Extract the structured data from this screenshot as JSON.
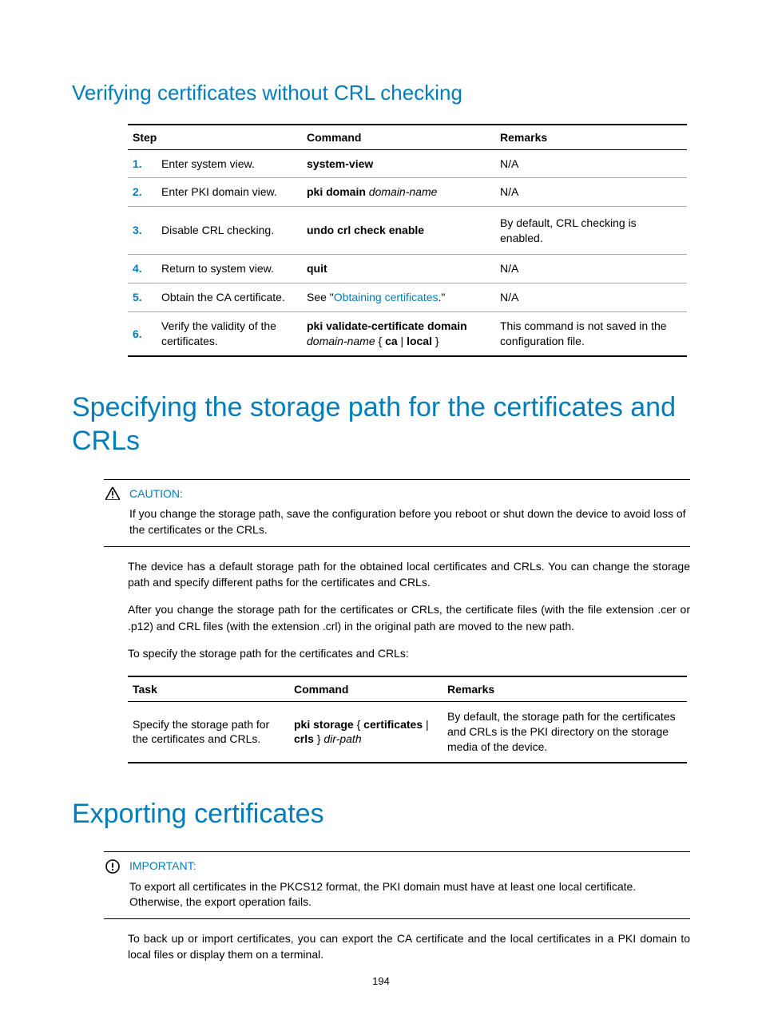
{
  "headings": {
    "verify": "Verifying certificates without CRL checking",
    "storage": "Specifying the storage path for the certificates and CRLs",
    "export": "Exporting certificates"
  },
  "table1": {
    "headers": {
      "step": "Step",
      "command": "Command",
      "remarks": "Remarks"
    },
    "rows": [
      {
        "num": "1.",
        "step": "Enter system view.",
        "cmd_b1": "system-view",
        "remarks": "N/A"
      },
      {
        "num": "2.",
        "step": "Enter PKI domain view.",
        "cmd_b1": "pki domain",
        "cmd_i1": " domain-name",
        "remarks": "N/A"
      },
      {
        "num": "3.",
        "step": "Disable CRL checking.",
        "cmd_b1": "undo crl check enable",
        "remarks": "By default, CRL checking is enabled."
      },
      {
        "num": "4.",
        "step": "Return to system view.",
        "cmd_b1": "quit",
        "remarks": "N/A"
      },
      {
        "num": "5.",
        "step": "Obtain the CA certificate.",
        "cmd_pre": "See \"",
        "cmd_link": "Obtaining certificates",
        "cmd_post": ".\"",
        "remarks": "N/A"
      },
      {
        "num": "6.",
        "step": "Verify the validity of the certificates.",
        "cmd_b1": "pki validate-certificate domain",
        "cmd_nl": true,
        "cmd_i1": "domain-name",
        "cmd_plain": " { ",
        "cmd_b2": "ca",
        "cmd_plain2": " | ",
        "cmd_b3": "local",
        "cmd_plain3": " }",
        "remarks": "This command is not saved in the configuration file."
      }
    ]
  },
  "caution": {
    "label": "CAUTION:",
    "text": "If you change the storage path, save the configuration before you reboot or shut down the device to avoid loss of the certificates or the CRLs."
  },
  "storage_paras": {
    "p1": "The device has a default storage path for the obtained local certificates and CRLs. You can change the storage path and specify different paths for the certificates and CRLs.",
    "p2": "After you change the storage path for the certificates or CRLs, the certificate files (with the file extension .cer or .p12) and CRL files (with the extension .crl) in the original path are moved to the new path.",
    "p3": "To specify the storage path for the certificates and CRLs:"
  },
  "table2": {
    "headers": {
      "task": "Task",
      "command": "Command",
      "remarks": "Remarks"
    },
    "row": {
      "task": "Specify the storage path for the certificates and CRLs.",
      "cmd_b1": "pki storage",
      "cmd_plain1": " { ",
      "cmd_b2": "certificates",
      "cmd_plain2": " | ",
      "cmd_b3": "crls",
      "cmd_plain3": " } ",
      "cmd_i1": "dir-path",
      "remarks": "By default, the storage path for the certificates and CRLs is the PKI directory on the storage media of the device."
    }
  },
  "important": {
    "label": "IMPORTANT:",
    "text": "To export all certificates in the PKCS12 format, the PKI domain must have at least one local certificate. Otherwise, the export operation fails."
  },
  "export_para": "To back up or import certificates, you can export the CA certificate and the local certificates in a PKI domain to local files or display them on a terminal.",
  "page_number": "194"
}
